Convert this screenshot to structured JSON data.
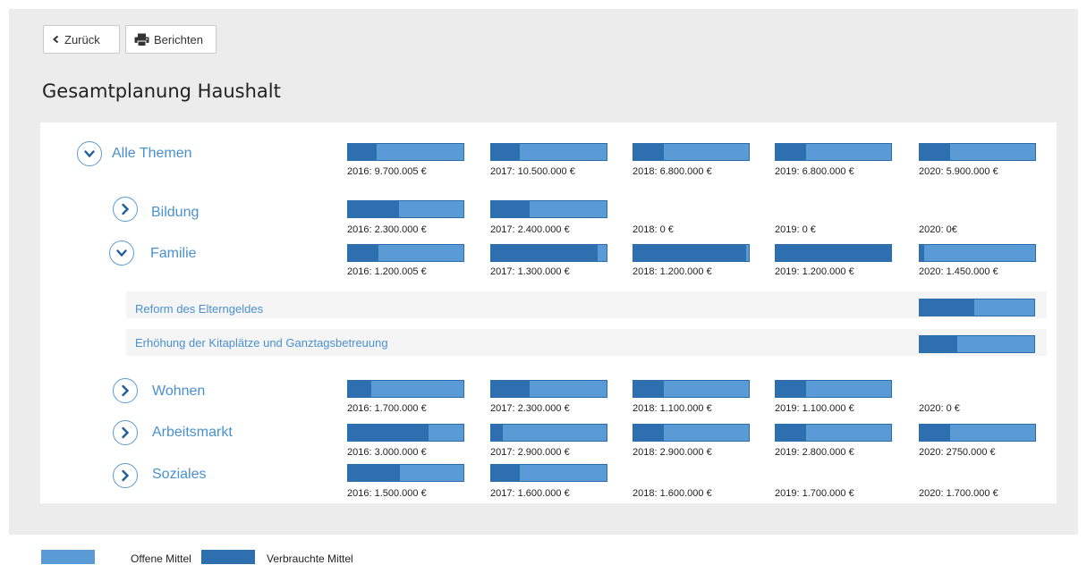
{
  "toolbar": {
    "back_label": "Zurück",
    "report_label": "Berichten"
  },
  "title": "Gesamtplanung Haushalt",
  "colors": {
    "offene": "#5b9bd5",
    "verbrauchte": "#2e6faf",
    "label": "#4a90d0"
  },
  "icons": {
    "back": "chevron-left-icon",
    "report": "printer-icon",
    "expanded": "chevron-down-icon",
    "collapsed": "chevron-right-icon"
  },
  "rows": [
    {
      "label": "Alle Themen",
      "expanded": true,
      "cells": [
        {
          "label": "2016: 9.700.005 €",
          "bar": true,
          "used": 0.25
        },
        {
          "label": "2017: 10.500.000 €",
          "bar": true,
          "used": 0.25
        },
        {
          "label": "2018: 6.800.000 €",
          "bar": true,
          "used": 0.26
        },
        {
          "label": "2019: 6.800.000 €",
          "bar": true,
          "used": 0.26
        },
        {
          "label": "2020: 5.900.000 €",
          "bar": true,
          "used": 0.26
        }
      ]
    },
    {
      "label": "Bildung",
      "expanded": false,
      "cells": [
        {
          "label": "2016: 2.300.000 €",
          "bar": true,
          "used": 0.44
        },
        {
          "label": "2017: 2.400.000 €",
          "bar": true,
          "used": 0.33
        },
        {
          "label": "2018: 0 €",
          "bar": false,
          "used": 0
        },
        {
          "label": "2019: 0 €",
          "bar": false,
          "used": 0
        },
        {
          "label": "2020: 0€",
          "bar": false,
          "used": 0
        }
      ]
    },
    {
      "label": "Familie",
      "expanded": true,
      "cells": [
        {
          "label": "2016: 1.200.005 €",
          "bar": true,
          "used": 0.26
        },
        {
          "label": "2017: 1.300.000 €",
          "bar": true,
          "used": 0.92
        },
        {
          "label": "2018: 1.200.000 €",
          "bar": true,
          "used": 0.98
        },
        {
          "label": "2019: 1.200.000 €",
          "bar": true,
          "used": 1.0
        },
        {
          "label": "2020: 1.450.000 €",
          "bar": true,
          "used": 0.04
        }
      ]
    },
    {
      "label": "Wohnen",
      "expanded": false,
      "cells": [
        {
          "label": "2016: 1.700.000 €",
          "bar": true,
          "used": 0.2
        },
        {
          "label": "2017: 2.300.000 €",
          "bar": true,
          "used": 0.33
        },
        {
          "label": "2018: 1.100.000 €",
          "bar": true,
          "used": 0.26
        },
        {
          "label": "2019: 1.100.000 €",
          "bar": true,
          "used": 0.26
        },
        {
          "label": "2020: 0 €",
          "bar": false,
          "used": 0
        }
      ]
    },
    {
      "label": "Arbeitsmarkt",
      "expanded": false,
      "cells": [
        {
          "label": "2016: 3.000.000 €",
          "bar": true,
          "used": 0.7
        },
        {
          "label": "2017: 2.900.000 €",
          "bar": true,
          "used": 0.1
        },
        {
          "label": "2018: 2.900.000 €",
          "bar": true,
          "used": 0.26
        },
        {
          "label": "2019: 2.800.000 €",
          "bar": true,
          "used": 0.26
        },
        {
          "label": "2020: 2750.000 €",
          "bar": true,
          "used": 0.26
        }
      ]
    },
    {
      "label": "Soziales",
      "expanded": false,
      "cells": [
        {
          "label": "2016: 1.500.000 €",
          "bar": true,
          "used": 0.45
        },
        {
          "label": "2017: 1.600.000 €",
          "bar": true,
          "used": 0.25
        },
        {
          "label": "2018: 1.600.000 €",
          "bar": false,
          "used": 0
        },
        {
          "label": "2019: 1.700.000 €",
          "bar": false,
          "used": 0
        },
        {
          "label": "2020: 1.700.000 €",
          "bar": false,
          "used": 0
        }
      ]
    }
  ],
  "subitems": [
    {
      "label": "Reform des Elterngeldes",
      "used": 0.48
    },
    {
      "label": "Erhöhung der Kitaplätze und Ganztagsbetreuung",
      "used": 0.33
    }
  ],
  "legend": {
    "offene_label": "Offene Mittel",
    "verbrauchte_label": "Verbrauchte Mittel"
  }
}
